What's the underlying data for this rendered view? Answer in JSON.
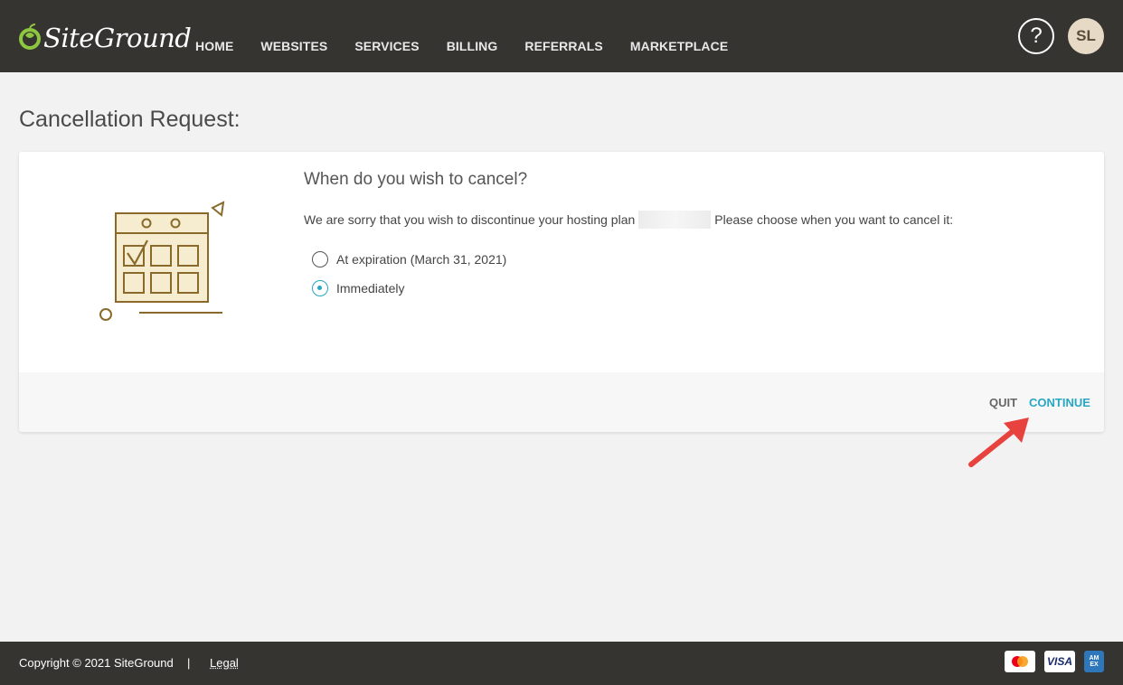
{
  "brand": {
    "name": "SiteGround",
    "logo_color": "#8dc63f"
  },
  "nav": {
    "items": [
      {
        "label": "HOME"
      },
      {
        "label": "WEBSITES"
      },
      {
        "label": "SERVICES"
      },
      {
        "label": "BILLING"
      },
      {
        "label": "REFERRALS"
      },
      {
        "label": "MARKETPLACE"
      }
    ]
  },
  "header": {
    "help_label": "?",
    "avatar_initials": "SL"
  },
  "page": {
    "title": "Cancellation Request:"
  },
  "card": {
    "question": "When do you wish to cancel?",
    "desc_before": "We are sorry that you wish to discontinue your hosting plan",
    "desc_after": "Please choose when you want to cancel it:",
    "options": [
      {
        "label": "At expiration (March 31, 2021)",
        "checked": false
      },
      {
        "label": "Immediately",
        "checked": true
      }
    ],
    "quit_label": "QUIT",
    "continue_label": "CONTINUE"
  },
  "footer": {
    "copyright": "Copyright © 2021 SiteGround",
    "separator": "|",
    "legal": "Legal",
    "payments": {
      "visa": "VISA",
      "amex": "AM EX"
    }
  },
  "colors": {
    "header_bg": "#363431",
    "accent": "#27a7c4",
    "illustration": "#8a6a2a",
    "illustration_fill": "#f6ecd0",
    "annotation_arrow": "#e8423f"
  }
}
